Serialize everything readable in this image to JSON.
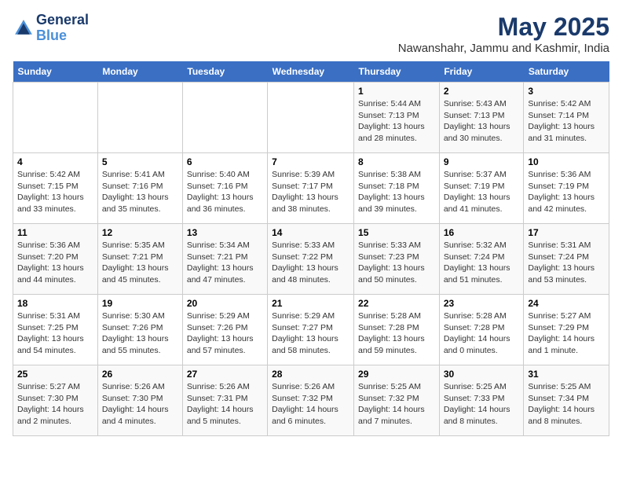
{
  "logo": {
    "line1": "General",
    "line2": "Blue"
  },
  "title": "May 2025",
  "location": "Nawanshahr, Jammu and Kashmir, India",
  "weekdays": [
    "Sunday",
    "Monday",
    "Tuesday",
    "Wednesday",
    "Thursday",
    "Friday",
    "Saturday"
  ],
  "weeks": [
    [
      {
        "day": "",
        "sunrise": "",
        "sunset": "",
        "daylight": ""
      },
      {
        "day": "",
        "sunrise": "",
        "sunset": "",
        "daylight": ""
      },
      {
        "day": "",
        "sunrise": "",
        "sunset": "",
        "daylight": ""
      },
      {
        "day": "",
        "sunrise": "",
        "sunset": "",
        "daylight": ""
      },
      {
        "day": "1",
        "sunrise": "5:44 AM",
        "sunset": "7:13 PM",
        "daylight": "13 hours and 28 minutes."
      },
      {
        "day": "2",
        "sunrise": "5:43 AM",
        "sunset": "7:13 PM",
        "daylight": "13 hours and 30 minutes."
      },
      {
        "day": "3",
        "sunrise": "5:42 AM",
        "sunset": "7:14 PM",
        "daylight": "13 hours and 31 minutes."
      }
    ],
    [
      {
        "day": "4",
        "sunrise": "5:42 AM",
        "sunset": "7:15 PM",
        "daylight": "13 hours and 33 minutes."
      },
      {
        "day": "5",
        "sunrise": "5:41 AM",
        "sunset": "7:16 PM",
        "daylight": "13 hours and 35 minutes."
      },
      {
        "day": "6",
        "sunrise": "5:40 AM",
        "sunset": "7:16 PM",
        "daylight": "13 hours and 36 minutes."
      },
      {
        "day": "7",
        "sunrise": "5:39 AM",
        "sunset": "7:17 PM",
        "daylight": "13 hours and 38 minutes."
      },
      {
        "day": "8",
        "sunrise": "5:38 AM",
        "sunset": "7:18 PM",
        "daylight": "13 hours and 39 minutes."
      },
      {
        "day": "9",
        "sunrise": "5:37 AM",
        "sunset": "7:19 PM",
        "daylight": "13 hours and 41 minutes."
      },
      {
        "day": "10",
        "sunrise": "5:36 AM",
        "sunset": "7:19 PM",
        "daylight": "13 hours and 42 minutes."
      }
    ],
    [
      {
        "day": "11",
        "sunrise": "5:36 AM",
        "sunset": "7:20 PM",
        "daylight": "13 hours and 44 minutes."
      },
      {
        "day": "12",
        "sunrise": "5:35 AM",
        "sunset": "7:21 PM",
        "daylight": "13 hours and 45 minutes."
      },
      {
        "day": "13",
        "sunrise": "5:34 AM",
        "sunset": "7:21 PM",
        "daylight": "13 hours and 47 minutes."
      },
      {
        "day": "14",
        "sunrise": "5:33 AM",
        "sunset": "7:22 PM",
        "daylight": "13 hours and 48 minutes."
      },
      {
        "day": "15",
        "sunrise": "5:33 AM",
        "sunset": "7:23 PM",
        "daylight": "13 hours and 50 minutes."
      },
      {
        "day": "16",
        "sunrise": "5:32 AM",
        "sunset": "7:24 PM",
        "daylight": "13 hours and 51 minutes."
      },
      {
        "day": "17",
        "sunrise": "5:31 AM",
        "sunset": "7:24 PM",
        "daylight": "13 hours and 53 minutes."
      }
    ],
    [
      {
        "day": "18",
        "sunrise": "5:31 AM",
        "sunset": "7:25 PM",
        "daylight": "13 hours and 54 minutes."
      },
      {
        "day": "19",
        "sunrise": "5:30 AM",
        "sunset": "7:26 PM",
        "daylight": "13 hours and 55 minutes."
      },
      {
        "day": "20",
        "sunrise": "5:29 AM",
        "sunset": "7:26 PM",
        "daylight": "13 hours and 57 minutes."
      },
      {
        "day": "21",
        "sunrise": "5:29 AM",
        "sunset": "7:27 PM",
        "daylight": "13 hours and 58 minutes."
      },
      {
        "day": "22",
        "sunrise": "5:28 AM",
        "sunset": "7:28 PM",
        "daylight": "13 hours and 59 minutes."
      },
      {
        "day": "23",
        "sunrise": "5:28 AM",
        "sunset": "7:28 PM",
        "daylight": "14 hours and 0 minutes."
      },
      {
        "day": "24",
        "sunrise": "5:27 AM",
        "sunset": "7:29 PM",
        "daylight": "14 hours and 1 minute."
      }
    ],
    [
      {
        "day": "25",
        "sunrise": "5:27 AM",
        "sunset": "7:30 PM",
        "daylight": "14 hours and 2 minutes."
      },
      {
        "day": "26",
        "sunrise": "5:26 AM",
        "sunset": "7:30 PM",
        "daylight": "14 hours and 4 minutes."
      },
      {
        "day": "27",
        "sunrise": "5:26 AM",
        "sunset": "7:31 PM",
        "daylight": "14 hours and 5 minutes."
      },
      {
        "day": "28",
        "sunrise": "5:26 AM",
        "sunset": "7:32 PM",
        "daylight": "14 hours and 6 minutes."
      },
      {
        "day": "29",
        "sunrise": "5:25 AM",
        "sunset": "7:32 PM",
        "daylight": "14 hours and 7 minutes."
      },
      {
        "day": "30",
        "sunrise": "5:25 AM",
        "sunset": "7:33 PM",
        "daylight": "14 hours and 8 minutes."
      },
      {
        "day": "31",
        "sunrise": "5:25 AM",
        "sunset": "7:34 PM",
        "daylight": "14 hours and 8 minutes."
      }
    ]
  ],
  "labels": {
    "sunrise": "Sunrise:",
    "sunset": "Sunset:",
    "daylight": "Daylight:"
  }
}
